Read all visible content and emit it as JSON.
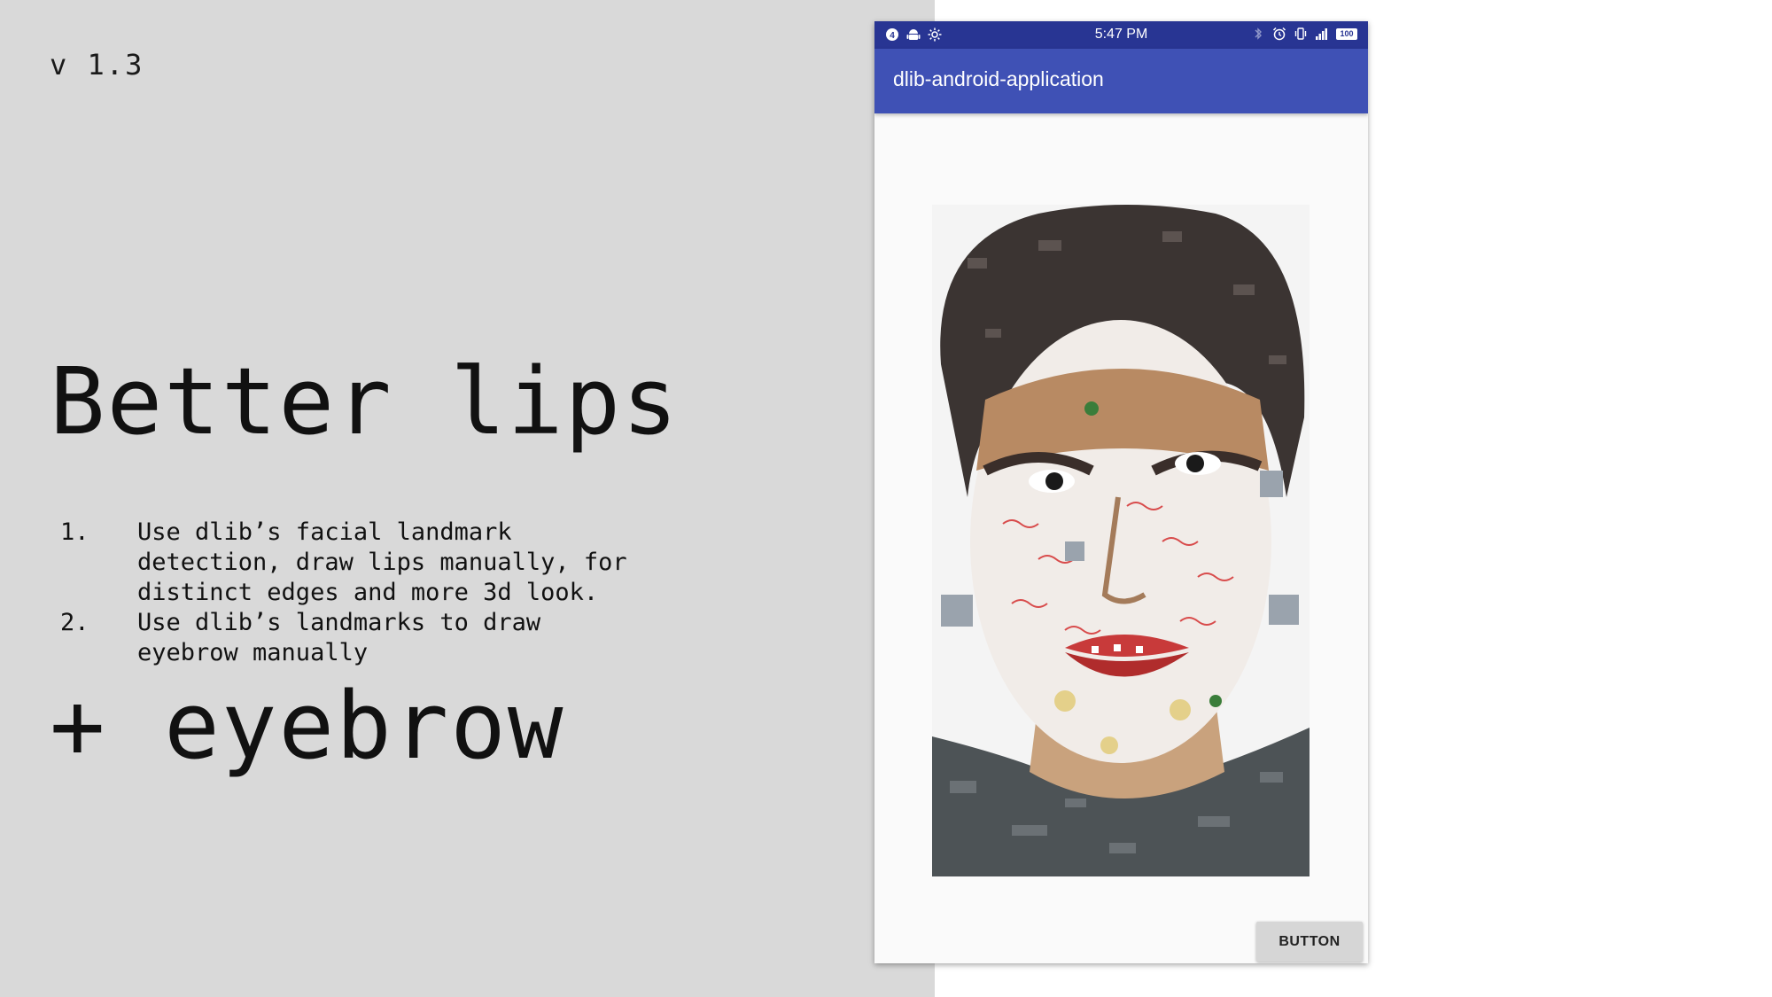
{
  "slide": {
    "version": "v 1.3",
    "title_lines": [
      "Better lips",
      "+ eyebrow"
    ],
    "steps": [
      {
        "number": "1.",
        "text": "Use dlib’s facial landmark detection, draw lips manually, for distinct edges and more 3d look."
      },
      {
        "number": "2.",
        "text": "Use dlib’s landmarks to draw eyebrow manually"
      }
    ]
  },
  "phone": {
    "status_bar": {
      "time": "5:47 PM",
      "battery": "100",
      "left_icons": [
        "notification-badge-icon",
        "android-icon",
        "brightness-icon"
      ],
      "right_icons": [
        "bluetooth-icon",
        "alarm-icon",
        "vibrate-icon",
        "signal-icon",
        "battery-icon"
      ]
    },
    "app_bar": {
      "title": "dlib-android-application"
    },
    "image": {
      "description_icon": "face-mosaic-image"
    },
    "button": {
      "label": "BUTTON"
    }
  },
  "colors": {
    "slide_background": "#d9d9d9",
    "status_bar": "#283593",
    "app_bar": "#3f51b5",
    "phone_background": "#fafafa",
    "button": "#d6d6d6"
  }
}
